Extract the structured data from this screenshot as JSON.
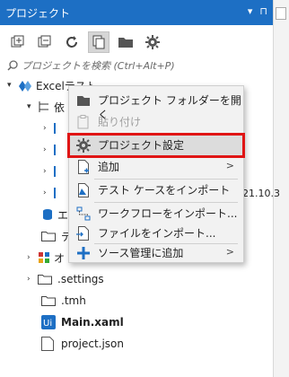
{
  "panel": {
    "title": "プロジェクト",
    "ctrl_pin": "▾ ⊓"
  },
  "search": {
    "placeholder": "プロジェクトを検索 (Ctrl+Alt+P)"
  },
  "tree": {
    "root": "Excelテスト",
    "partial_items": [
      "依",
      "エ",
      "テ",
      "オ"
    ],
    "version_fragment": "21.10.3",
    "items": [
      ".settings",
      ".tmh",
      "Main.xaml",
      "project.json"
    ]
  },
  "context_menu": {
    "items": [
      {
        "label": "プロジェクト フォルダーを開く",
        "icon": "folder-open-icon"
      },
      {
        "label": "貼り付け",
        "icon": "paste-icon",
        "disabled": true
      },
      {
        "label": "プロジェクト設定",
        "icon": "gear-icon",
        "highlighted": true
      },
      {
        "label": "追加",
        "icon": "add-file-icon",
        "submenu": true
      },
      {
        "label": "テスト ケースをインポート",
        "icon": "test-import-icon"
      },
      {
        "label": "ワークフローをインポート...",
        "icon": "workflow-import-icon"
      },
      {
        "label": "ファイルをインポート...",
        "icon": "file-import-icon"
      },
      {
        "label": "ソース管理に追加",
        "icon": "plus-icon",
        "submenu": true
      }
    ],
    "submenu_arrow": ">"
  },
  "colors": {
    "titlebar": "#1d6fc4",
    "highlight_border": "#e01515",
    "accent_blue": "#1d6fc4"
  }
}
